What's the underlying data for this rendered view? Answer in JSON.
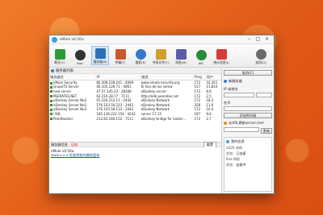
{
  "window": {
    "title": "eMule v0.50a"
  },
  "toolbar": {
    "items": [
      {
        "label": "断开(C)",
        "icon": "connect-icon",
        "color": "#2d9a3a"
      },
      {
        "label": "Kad",
        "icon": "kad-icon",
        "color": "#333333"
      },
      {
        "label": "服务器(S)",
        "icon": "server-icon",
        "color": "#2f6fb7"
      },
      {
        "label": "传输(T)",
        "icon": "transfer-icon",
        "color": "#c9592c"
      },
      {
        "label": "搜索(E)",
        "icon": "search-icon",
        "color": "#3779c7"
      },
      {
        "label": "共享文件(F)",
        "icon": "shared-files-icon",
        "color": "#d0a030"
      },
      {
        "label": "消息(M)",
        "icon": "messages-icon",
        "color": "#5b5ba8"
      },
      {
        "label": "IRC",
        "icon": "irc-icon",
        "color": "#2a8a3a"
      },
      {
        "label": "统计信息(I)",
        "icon": "statistics-icon",
        "color": "#d63a3a"
      },
      {
        "label": "选项(O)",
        "icon": "options-icon",
        "color": "#6a6a6a"
      }
    ]
  },
  "servers": {
    "heading": "服务器列表",
    "columns": [
      "服务器名",
      "IP",
      "描述",
      "Ping",
      "用户"
    ],
    "rows": [
      {
        "name": "eMule Security",
        "ip": "80.208.228.241 : 8369",
        "desc": "www.emule-security.org",
        "ping": "172",
        "users": "33,161"
      },
      {
        "name": "GrupoTS Server",
        "ip": "46.105.126.71 : 4661",
        "desc": "El foro de los semw",
        "ping": "157",
        "users": "11,810"
      },
      {
        "name": "new server",
        "ip": "47.57.145.23 : 28208",
        "desc": "eDonkey server",
        "ping": "172",
        "users": "8,6"
      },
      {
        "name": "PEERATES.NET",
        "ip": "62.210.28.77 : 7111",
        "desc": "http://edk.peerates.net",
        "ping": "172",
        "users": "2,5"
      },
      {
        "name": "eDonkey Server No2",
        "ip": "91.226.212.11 : 2442",
        "desc": "eDonkey Network",
        "ping": "172",
        "users": "18,3"
      },
      {
        "name": "eDonkey Server No1",
        "ip": "176.103.50.223 : 2442",
        "desc": "eDonkey Network",
        "ping": "328",
        "users": "11,6"
      },
      {
        "name": "eDonkey Server No3",
        "ip": "176.103.56.133 : 2442",
        "desc": "eDonkey Network",
        "ping": "172",
        "users": "10,4"
      },
      {
        "name": "!!KB",
        "ip": "185.136.222.154 : 4242",
        "desc": "server 17.15",
        "ping": "187",
        "users": "9,6"
      },
      {
        "name": "PeerBooster",
        "ip": "212.83.184.152 : 7111",
        "desc": "eDonkey bridge for kaden...",
        "ping": "172",
        "users": "2,7"
      }
    ]
  },
  "log": {
    "tab_server_info": "服务器信息",
    "tab_log": "日志",
    "reset": "重置",
    "line1": "eMule v0.50a",
    "line2": "www.x.x.x 检查更新的最新版本"
  },
  "side": {
    "new_server_heading": "新服务器",
    "connect_button": "取消(C)",
    "add_server_label": "添加服务器",
    "address_label": "IP 或地址",
    "port_label": "端口",
    "name_label": "名字",
    "add_button": "添加到列表",
    "update_label": "从URL更新server.met",
    "update_button": "更新",
    "my_info_heading": "我的信息",
    "info": [
      {
        "k": "eD2K 网络",
        "v": ""
      },
      {
        "k": "状态:",
        "v": "已连接"
      },
      {
        "k": "Kad 网络",
        "v": ""
      },
      {
        "k": "状态:",
        "v": "连接中"
      }
    ]
  }
}
